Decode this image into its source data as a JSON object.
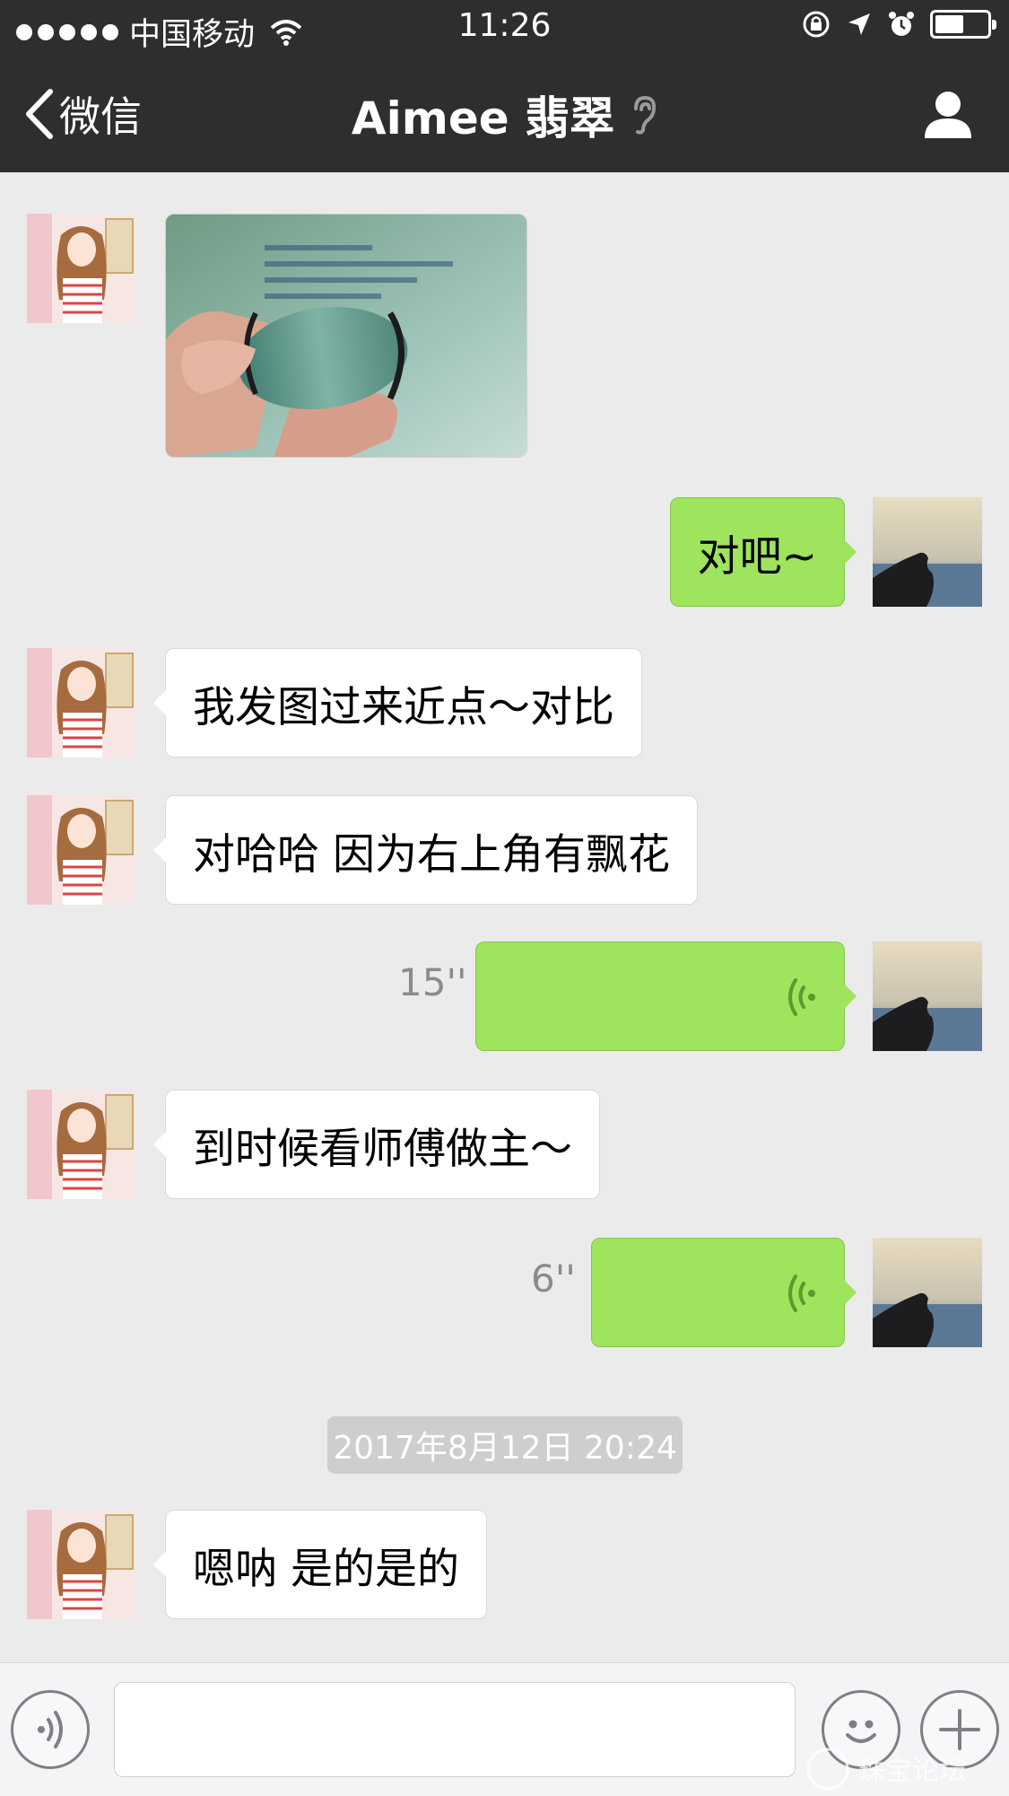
{
  "status_bar": {
    "carrier": "中国移动",
    "time": "11:26",
    "battery_level": 0.55
  },
  "nav": {
    "back_label": "微信",
    "title": "Aimee 翡翠"
  },
  "messages": [
    {
      "side": "in",
      "type": "image",
      "caption_lines": [
        "手持翡翠挂件",
        "",
        "",
        ""
      ]
    },
    {
      "side": "out",
      "type": "text",
      "text": "对吧~"
    },
    {
      "side": "in",
      "type": "text",
      "text": "我发图过来近点～对比"
    },
    {
      "side": "in",
      "type": "text",
      "text": "对哈哈 因为右上角有飘花"
    },
    {
      "side": "out",
      "type": "voice",
      "duration": "15''"
    },
    {
      "side": "in",
      "type": "text",
      "text": "到时候看师傅做主～"
    },
    {
      "side": "out",
      "type": "voice",
      "duration": "6''"
    },
    {
      "side": "in",
      "type": "text",
      "text": "嗯呐 是的是的"
    }
  ],
  "timestamp": "2017年8月12日 20:24",
  "input": {
    "placeholder": "",
    "value": ""
  },
  "colors": {
    "nav_bg": "#2e2e30",
    "chat_bg": "#ebebeb",
    "out_bubble": "#9ee45c",
    "in_bubble": "#ffffff",
    "voice_wave": "#5a9a2e"
  },
  "watermark": "珠宝论坛"
}
